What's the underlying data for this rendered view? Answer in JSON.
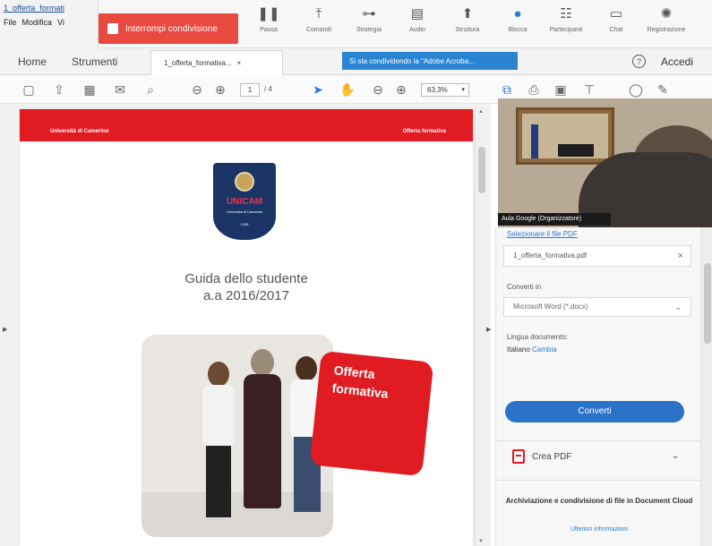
{
  "app": {
    "doc_tab_title": "1_offerta_formati",
    "menu": [
      "File",
      "Modifica",
      "Vi"
    ]
  },
  "meeting": {
    "share_label": "Interrompi condivisione",
    "tools": [
      {
        "label": "Pausa",
        "icon": "pause-icon"
      },
      {
        "label": "Comandi",
        "icon": "upload-icon"
      },
      {
        "label": "Strategia",
        "icon": "hierarchy-icon"
      },
      {
        "label": "Audio",
        "icon": "chat-square-icon"
      },
      {
        "label": "Struttura",
        "icon": "pointer-icon"
      },
      {
        "label": "Blocca",
        "icon": "pen-circle-icon"
      },
      {
        "label": "Partecipanti",
        "icon": "participants-icon"
      },
      {
        "label": "Chat",
        "icon": "chat-icon"
      },
      {
        "label": "Registrazione",
        "icon": "record-icon"
      }
    ]
  },
  "tabs": {
    "home": "Home",
    "tools": "Strumenti",
    "document": "1_offerta_formativa...",
    "document_close": "×",
    "notice": "Si sta condividendo la \"Adobe Acroba...",
    "help": "?",
    "signin": "Accedi"
  },
  "toolbar": {
    "page_current": "1",
    "page_total": "/ 4",
    "zoom": "63,3%",
    "icons": [
      "new-file-icon",
      "upload-cloud-icon",
      "print-icon",
      "mail-icon",
      "search-icon",
      "prev-page-icon",
      "next-page-icon",
      "cursor-icon",
      "hand-icon",
      "zoom-out-icon",
      "zoom-in-icon",
      "fit-page-icon",
      "export-icon",
      "scan-icon",
      "stamp-icon",
      "comment-icon",
      "sign-icon"
    ]
  },
  "document": {
    "header_left": "Università di Camerino",
    "header_right": "Offerta formativa",
    "crest_name": "UNICAM",
    "crest_sub": "Università di Camerino",
    "crest_year": "1336",
    "title_line1": "Guida dello studente",
    "title_line2": "a.a 2016/2017",
    "offer_line1": "Offerta",
    "offer_line2": "formativa"
  },
  "webcam": {
    "label": "Aula Google (Organizzatore)"
  },
  "panel": {
    "select_link": "Selezionare il file PDF",
    "file_name": "1_offerta_formativa.pdf",
    "clear": "×",
    "convert_to_label": "Converti in",
    "format_value": "Microsoft Word (*.docx)",
    "language_label": "Lingua documento:",
    "language_value": "Italiano",
    "language_change": "Cambia",
    "convert_button": "Converti",
    "create_pdf": "Crea PDF",
    "promo_text": "Archiviazione e condivisione di file in Document Cloud",
    "promo_link": "Ulteriori informazioni"
  },
  "colors": {
    "accent_red": "#e11b22",
    "share_red": "#e84a3f",
    "accent_blue": "#2a73c9",
    "crest_blue": "#1b3466"
  }
}
